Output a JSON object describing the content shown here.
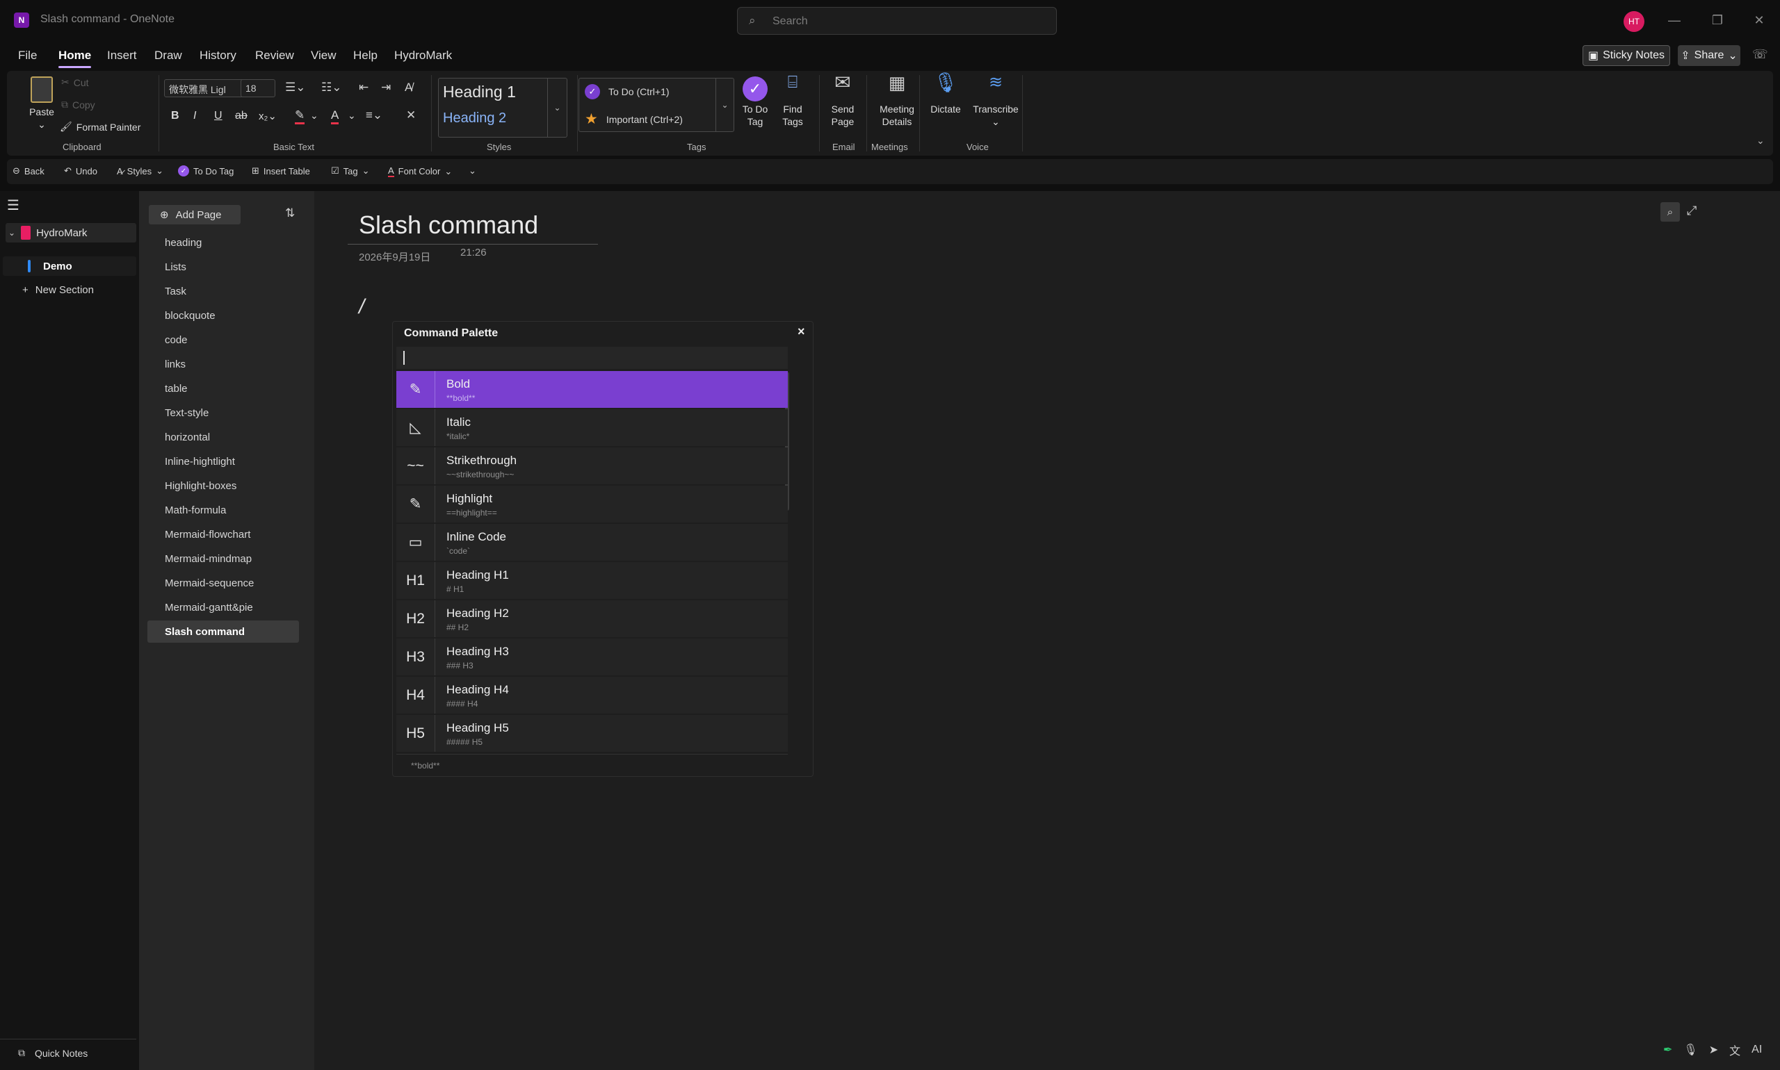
{
  "window": {
    "title": "Slash command",
    "app": "OneNote",
    "search_placeholder": "Search",
    "avatar": "HT"
  },
  "menu": [
    "File",
    "Home",
    "Insert",
    "Draw",
    "History",
    "Review",
    "View",
    "Help",
    "HydroMark"
  ],
  "top_right": {
    "sticky": "Sticky Notes",
    "share": "Share"
  },
  "ribbon": {
    "clipboard": {
      "paste": "Paste",
      "cut": "Cut",
      "copy": "Copy",
      "format_painter": "Format Painter",
      "label": "Clipboard"
    },
    "basic_text": {
      "font": "微软雅黑 Ligl",
      "size": "18",
      "label": "Basic Text"
    },
    "styles": {
      "h1": "Heading 1",
      "h2": "Heading 2",
      "label": "Styles"
    },
    "tags": {
      "todo": "To Do (Ctrl+1)",
      "important": "Important (Ctrl+2)",
      "todo_tag_1": "To Do",
      "todo_tag_2": "Tag",
      "find_1": "Find",
      "find_2": "Tags",
      "label": "Tags"
    },
    "email": {
      "l1": "Send",
      "l2": "Page",
      "label": "Email"
    },
    "meetings": {
      "l1": "Meeting",
      "l2": "Details",
      "label": "Meetings"
    },
    "voice": {
      "dictate": "Dictate",
      "transcribe": "Transcribe",
      "label": "Voice"
    }
  },
  "qat": {
    "back": "Back",
    "undo": "Undo",
    "styles": "Styles",
    "todo": "To Do Tag",
    "table": "Insert Table",
    "tag": "Tag",
    "font_color": "Font Color"
  },
  "nav": {
    "notebook": "HydroMark",
    "section": "Demo",
    "new_section": "New Section",
    "quick_notes": "Quick Notes"
  },
  "pages": {
    "add": "Add Page",
    "items": [
      "heading",
      "Lists",
      "Task",
      "blockquote",
      "code",
      "links",
      "table",
      "Text-style",
      "horizontal",
      "Inline-hightlight",
      "Highlight-boxes",
      "Math-formula",
      "Mermaid-flowchart",
      "Mermaid-mindmap",
      "Mermaid-sequence",
      "Mermaid-gantt&pie",
      "Slash command"
    ]
  },
  "note": {
    "title": "Slash command",
    "date": "2026年9月19日",
    "time": "21:26",
    "body": "/"
  },
  "palette": {
    "title": "Command Palette",
    "close": "×",
    "footer": "**bold**",
    "items": [
      {
        "icon": "✎",
        "name": "Bold",
        "syntax": "**bold**"
      },
      {
        "icon": "◺",
        "name": "Italic",
        "syntax": "*italic*"
      },
      {
        "icon": "~~",
        "name": "Strikethrough",
        "syntax": "~~strikethrough~~"
      },
      {
        "icon": "✎",
        "name": "Highlight",
        "syntax": "==highlight=="
      },
      {
        "icon": "▭",
        "name": "Inline Code",
        "syntax": "`code`"
      },
      {
        "icon": "H1",
        "name": "Heading H1",
        "syntax": "# H1"
      },
      {
        "icon": "H2",
        "name": "Heading H2",
        "syntax": "## H2"
      },
      {
        "icon": "H3",
        "name": "Heading H3",
        "syntax": "### H3"
      },
      {
        "icon": "H4",
        "name": "Heading H4",
        "syntax": "#### H4"
      },
      {
        "icon": "H5",
        "name": "Heading H5",
        "syntax": "##### H5"
      }
    ]
  },
  "colors": {
    "accent": "#7a3fd0",
    "bg": "#1e1e1e"
  }
}
